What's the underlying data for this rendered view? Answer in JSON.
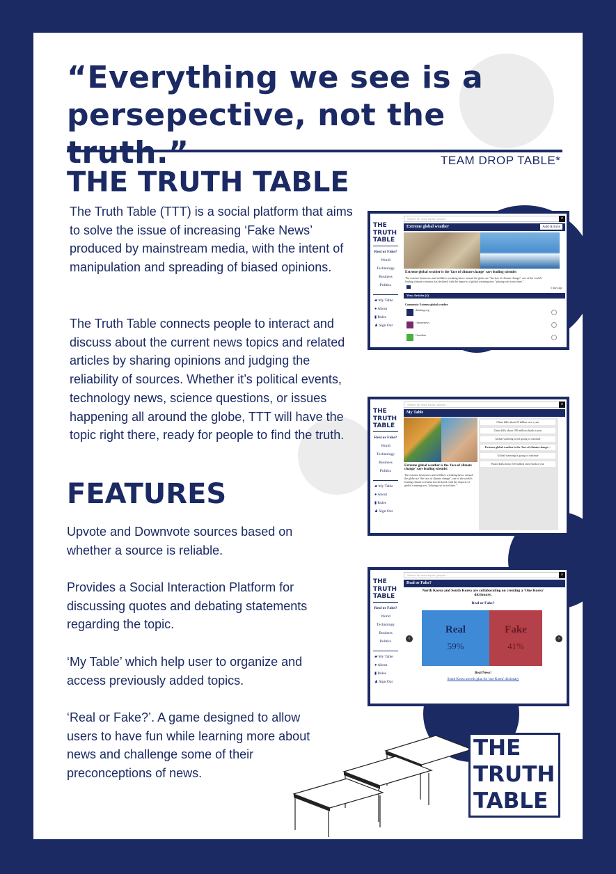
{
  "quote": {
    "line1": "“Everything we see is a",
    "line2": "persepective, not the truth.”"
  },
  "team": "TEAM DROP TABLE*",
  "title": "THE TRUTH TABLE",
  "intro": {
    "p1": "The Truth Table (TTT) is a social platform that aims to solve the issue of increasing ‘Fake News’ produced by mainstream media, with the intent of manipulation and spreading of biased opinions.",
    "p2": "The Truth Table connects people to interact and discuss about the current news topics and related articles by sharing opinions and judging the reliability of sources.  Whether it’s political events, technology news, science questions, or issues happening all around the globe, TTT will have the topic right there, ready for people to find the truth."
  },
  "features": {
    "heading": "FEATURES",
    "f1_a": "Upvote",
    "f1_b": " and ",
    "f1_c": "Downvote",
    "f1_d": " sources based on whether a source is reliable.",
    "f2_a": "Provides a ",
    "f2_b": "Social Interaction Platform",
    "f2_c": " for discussing quotes and debating statements regarding the topic.",
    "f3_a": "‘My Table’",
    "f3_b": " which help user to organize and access previously added topics.",
    "f4_a": "‘Real or Fake?’",
    "f4_b": ". A game designed to allow users to have fun while learning more about news and  challenge some of their preconceptions of news."
  },
  "app": {
    "logo": [
      "THE",
      "TRUTH",
      "TABLE"
    ],
    "search_placeholder": "Search for news topics, people...",
    "nav": [
      "Real or Fake?",
      "World",
      "Technology",
      "Business",
      "Politics"
    ],
    "nav2": [
      "My Table",
      "About",
      "Rules",
      "Sign Out"
    ]
  },
  "shot1": {
    "bar": "Extreme global weather",
    "add": "Add Article",
    "headline": "Extreme global weather is the 'face of climate change' says leading scientist",
    "body": "The extreme heatwaves and wildfires wreaking havoc around the globe are \"the face of climate change\", one of the world's leading climate scientists has declared, with the impacts of global warming now \"playing out in real time.\"",
    "meta": "5 days ago",
    "view_bar": "View Articles (4)",
    "list_title": "Comments: Extreme global weather",
    "rows": [
      "thinking.org",
      "climatenews",
      "Guardian"
    ]
  },
  "shot2": {
    "bar": "My Table",
    "headline": "Extreme global weather is the 'face of climate change' says leading scientist",
    "body": "The extreme heatwaves and wildfires wreaking havoc around the globe are \"the face of climate change\", one of the world's leading climate scientists has declared, with the impacts of global warming now \"playing out in real time.\"",
    "items": [
      "China kills about 65 billion rats a year",
      "China kills about 100 million sharks a year",
      "Global warming is not going to continue",
      "Extreme global weather is the 'face of climate change'...",
      "Global warming is going to continue",
      "Brazil kills about 100 million snow bulls a year"
    ]
  },
  "shot3": {
    "bar": "Real or Fake?",
    "question": "North Korea and South Korea are collaborating on creating a 'One Korea' dictionary.",
    "sub": "Real or Fake?",
    "real_label": "Real",
    "real_pct": "59%",
    "fake_label": "Fake",
    "fake_pct": "41%",
    "result": "Real News!",
    "link": "South Korea unveils plan for 'one Korea' dictionary"
  },
  "logo_box": [
    "THE",
    "TRUTH",
    "TABLE"
  ],
  "colors": {
    "navy": "#1b2a63",
    "real": "#3f8ad6",
    "fake": "#b4404a"
  }
}
